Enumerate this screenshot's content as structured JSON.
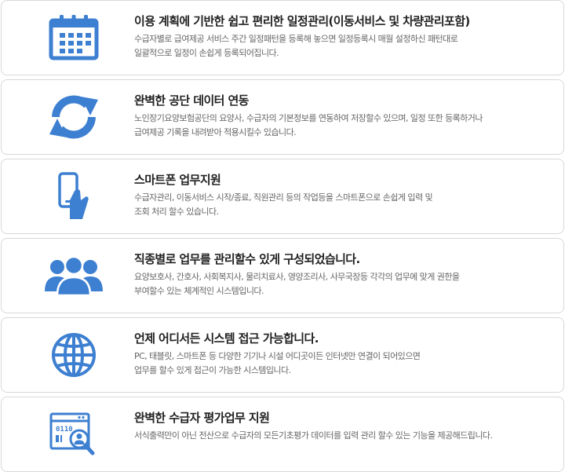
{
  "icon_color": "#3d7fd1",
  "features": [
    {
      "icon": "calendar-icon",
      "title": "이용 계획에 기반한 쉽고 편리한 일정관리(이동서비스 및 차량관리포함)",
      "desc_lines": [
        "수급자별로 급여제공 서비스 주간 일정패턴을 등록해 놓으면 일정등록시 매월 설정하신 패턴대로",
        "일괄적으로 일정이 손쉽게 등록되어집니다."
      ]
    },
    {
      "icon": "sync-arrows-icon",
      "title": "완벽한 공단 데이터 연동",
      "desc_lines": [
        "노인장기요양보험공단의 요양사, 수급자의 기본정보를 연동하여 저장할수 있으며, 일정 또한 등록하거나",
        "급여제공 기록을 내려받아 적용시킬수 있습니다."
      ]
    },
    {
      "icon": "smartphone-hand-icon",
      "title": "스마트폰 업무지원",
      "desc_lines": [
        "수급자관리, 이동서비스 시작/종료, 직원관리 등의 작업등을 스마트폰으로 손쉽게 입력 및",
        "조회 처리 할수 있습니다."
      ]
    },
    {
      "icon": "users-group-icon",
      "title": "직종별로 업무를 관리할수 있게 구성되었습니다.",
      "desc_lines": [
        "요양보호사, 간호사, 사회복지사, 물리치료사, 영양조리사, 사무국장등 각각의 업무에 맞게 권한을",
        "부여할수 있는 체계적인 시스템입니다."
      ]
    },
    {
      "icon": "globe-icon",
      "title": "언제 어디서든 시스템 접근 가능합니다.",
      "desc_lines": [
        "PC, 태블릿, 스마트폰 등 다양한 기기나 시설 어디곳이든 인터넷만 연결이 되어있으면",
        "업무를 할수 있게 접근이 가능한 시스템입니다."
      ]
    },
    {
      "icon": "evaluation-search-icon",
      "title": "완벽한 수급자 평가업무 지원",
      "desc_lines": [
        "서식출력만이 아닌 전산으로 수급자의 모든기초평가 데이터를 입력 관리 할수 있는 기능을 제공해드립니다."
      ]
    }
  ]
}
